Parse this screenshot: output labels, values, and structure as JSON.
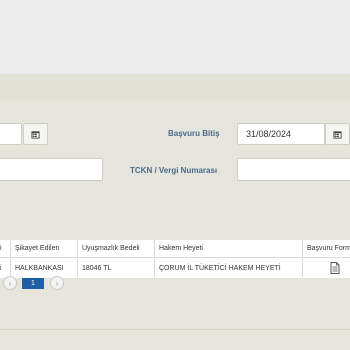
{
  "filters": {
    "basvuru_bitis_label": "Başvuru Bitiş",
    "basvuru_bitis_value": "31/08/2024",
    "tckn_label": "TCKN / Vergi Numarası",
    "tckn_value": ""
  },
  "table": {
    "headers": [
      "i",
      "Şikayet Edilen",
      "Uyuşmazlık Bedeli",
      "Hakem Heyeti",
      "Başvuru Form"
    ],
    "rows": [
      [
        "i",
        "HALKBANKASI",
        "18046 TL",
        "ÇORUM İL TÜKETİCİ HAKEM HEYETİ",
        ""
      ]
    ]
  },
  "pager": {
    "current_page": "1",
    "prev_symbol": "‹",
    "next_symbol": "›"
  },
  "icons": {
    "calendar": "calendar-icon",
    "document": "document-icon"
  }
}
